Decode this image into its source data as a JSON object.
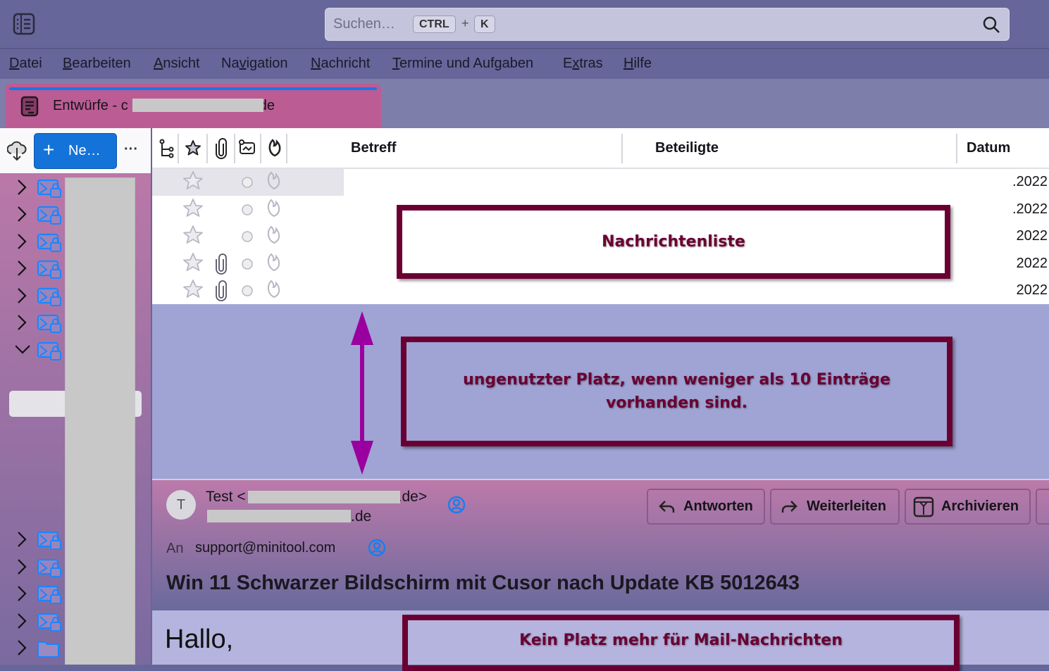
{
  "topbar": {
    "search_placeholder": "Suchen…",
    "kbd1": "CTRL",
    "plus": "+",
    "kbd2": "K"
  },
  "menu": [
    {
      "pre": "",
      "u": "D",
      "post": "atei"
    },
    {
      "pre": "",
      "u": "B",
      "post": "earbeiten"
    },
    {
      "pre": "",
      "u": "A",
      "post": "nsicht"
    },
    {
      "pre": "Na",
      "u": "v",
      "post": "igation"
    },
    {
      "pre": "",
      "u": "N",
      "post": "achricht"
    },
    {
      "pre": "",
      "u": "T",
      "post": "ermine und Aufgaben"
    },
    {
      "pre": "E",
      "u": "x",
      "post": "tras"
    },
    {
      "pre": "",
      "u": "H",
      "post": "ilfe"
    }
  ],
  "tab": {
    "label_start": "Entwürfe - c",
    "label_end": "de"
  },
  "toolbar": {
    "new_label": "Ne…",
    "more": "···"
  },
  "columns": {
    "subject": "Betreff",
    "participants": "Beteiligte",
    "date": "Datum"
  },
  "rows": [
    {
      "date": ".2022",
      "attach": false
    },
    {
      "date": ".2022",
      "attach": false
    },
    {
      "date": "2022",
      "attach": false
    },
    {
      "date": "2022",
      "attach": true
    },
    {
      "date": "2022",
      "attach": true
    }
  ],
  "message": {
    "avatar": "T",
    "from_start": "Test <",
    "from_end": ".de>",
    "from_line2_end": ".de",
    "to_label": "An",
    "to": "support@minitool.com",
    "subject": "Win 11 Schwarzer Bildschirm mit Cusor nach Update KB 5012643",
    "body_start": "Hallo,"
  },
  "actions": {
    "reply": "Antworten",
    "forward": "Weiterleiten",
    "archive": "Archivieren"
  },
  "annotations": {
    "list": "Nachrichtenliste",
    "unused": "ungenutzter Platz, wenn weniger als 10 Einträge vorhanden sind.",
    "nospace": "Kein Platz mehr für Mail-Nachrichten"
  },
  "colors": {
    "accent": "#1373d9",
    "annotation": "#6a0032",
    "arrow": "#9a00a0"
  }
}
